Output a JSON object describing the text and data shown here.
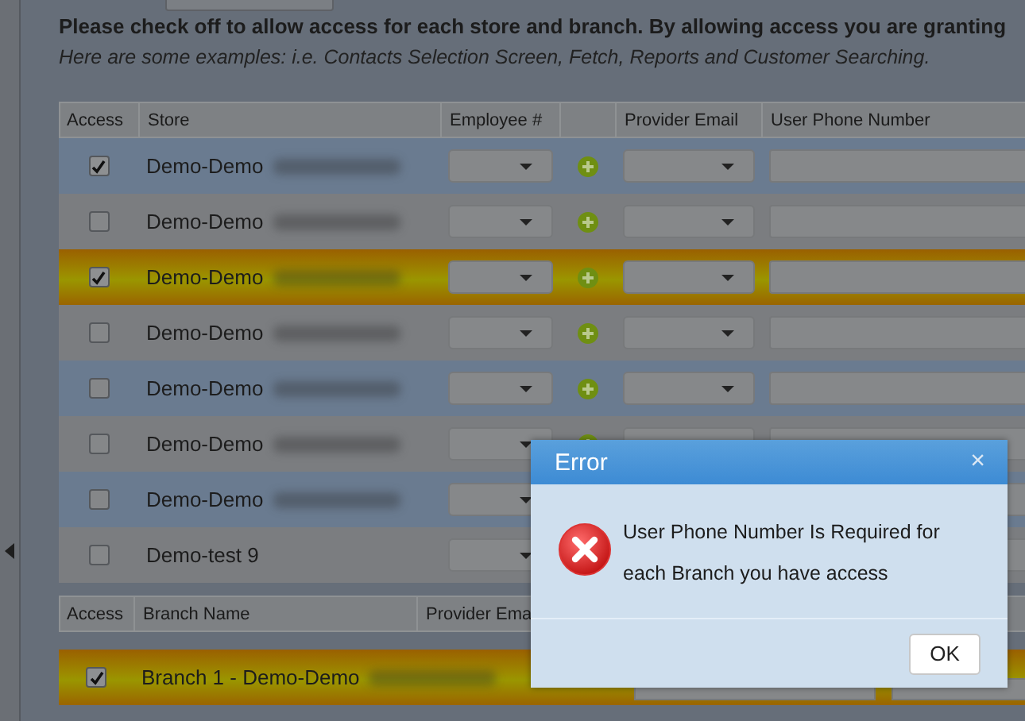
{
  "intro": {
    "heading": "Please check off to allow access for each store and branch. By allowing access you are granting",
    "note": "Here are some examples: i.e. Contacts Selection Screen, Fetch, Reports and Customer Searching."
  },
  "stores_table": {
    "columns": [
      "Access",
      "Store",
      "Employee #",
      "Provider Email",
      "User Phone Number"
    ],
    "rows": [
      {
        "store": "Demo-Demo",
        "redacted": true,
        "checked": true,
        "highlighted": false
      },
      {
        "store": "Demo-Demo",
        "redacted": true,
        "checked": false,
        "highlighted": false
      },
      {
        "store": "Demo-Demo",
        "redacted": true,
        "checked": true,
        "highlighted": true
      },
      {
        "store": "Demo-Demo",
        "redacted": true,
        "checked": false,
        "highlighted": false
      },
      {
        "store": "Demo-Demo",
        "redacted": true,
        "checked": false,
        "highlighted": false
      },
      {
        "store": "Demo-Demo",
        "redacted": true,
        "checked": false,
        "highlighted": false
      },
      {
        "store": "Demo-Demo",
        "redacted": true,
        "checked": false,
        "highlighted": false
      },
      {
        "store": "Demo-test 9",
        "redacted": false,
        "checked": false,
        "highlighted": false
      }
    ]
  },
  "branch_table": {
    "columns": [
      "Access",
      "Branch Name",
      "Provider Ema"
    ],
    "rows": [
      {
        "branch": "Branch 1 - Demo-Demo",
        "redacted": true,
        "checked": true,
        "highlighted": true
      }
    ]
  },
  "dialog": {
    "title": "Error",
    "close_label": "×",
    "message": "User Phone Number Is Required for each Branch you have access",
    "button": "OK"
  }
}
